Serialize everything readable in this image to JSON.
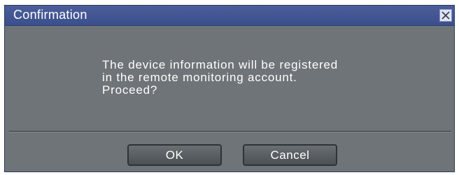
{
  "dialog": {
    "title": "Confirmation",
    "close_icon": "close-icon",
    "message_lines": [
      "The device information will be registered",
      "in the remote monitoring account.",
      "Proceed?"
    ],
    "ok_label": "OK",
    "cancel_label": "Cancel"
  },
  "colors": {
    "titlebar": "#3f528f",
    "body": "#6f7478",
    "button": "#565b5f"
  }
}
